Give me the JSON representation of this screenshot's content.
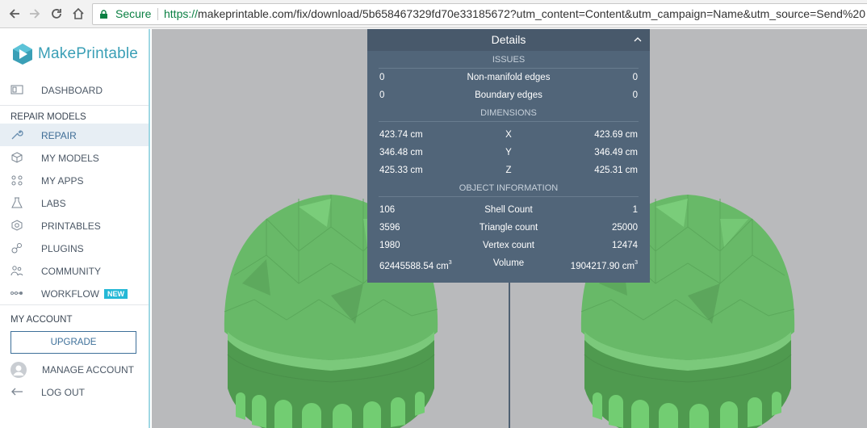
{
  "browser": {
    "secure_label": "Secure",
    "url_scheme": "https://",
    "url_rest": "makeprintable.com/fix/download/5b658467329fd70e33185672?utm_content=Content&utm_campaign=Name&utm_source=Send%20"
  },
  "sidebar": {
    "brand": "MakePrintable",
    "dashboard": "DASHBOARD",
    "section_repair": "REPAIR MODELS",
    "items": [
      {
        "label": "REPAIR",
        "icon": "wrench-icon"
      },
      {
        "label": "MY MODELS",
        "icon": "cube-icon"
      },
      {
        "label": "MY APPS",
        "icon": "apps-icon"
      },
      {
        "label": "LABS",
        "icon": "flask-icon"
      },
      {
        "label": "PRINTABLES",
        "icon": "printables-icon"
      },
      {
        "label": "PLUGINS",
        "icon": "plugins-icon"
      },
      {
        "label": "COMMUNITY",
        "icon": "community-icon"
      },
      {
        "label": "WORKFLOW",
        "icon": "workflow-icon",
        "badge": "NEW"
      }
    ],
    "section_account": "MY ACCOUNT",
    "upgrade": "UPGRADE",
    "manage_account": "MANAGE ACCOUNT",
    "log_out": "LOG OUT"
  },
  "details": {
    "title": "Details",
    "issues_header": "ISSUES",
    "issues": [
      {
        "left": "0",
        "label": "Non-manifold edges",
        "right": "0"
      },
      {
        "left": "0",
        "label": "Boundary edges",
        "right": "0"
      }
    ],
    "dimensions_header": "DIMENSIONS",
    "dimensions": [
      {
        "left": "423.74 cm",
        "label": "X",
        "right": "423.69 cm"
      },
      {
        "left": "346.48 cm",
        "label": "Y",
        "right": "346.49 cm"
      },
      {
        "left": "425.33 cm",
        "label": "Z",
        "right": "425.31 cm"
      }
    ],
    "object_header": "OBJECT INFORMATION",
    "object_info": [
      {
        "left": "106",
        "label": "Shell Count",
        "right": "1"
      },
      {
        "left": "3596",
        "label": "Triangle count",
        "right": "25000"
      },
      {
        "left": "1980",
        "label": "Vertex count",
        "right": "12474"
      },
      {
        "left": "62445588.54 cm",
        "label": "Volume",
        "right": "1904217.90 cm",
        "unit_sup": "3"
      }
    ]
  },
  "colors": {
    "accent": "#3a9fb6",
    "panel": "#516579",
    "model_green": "#6ec66e",
    "viewport": "#b9babc"
  }
}
